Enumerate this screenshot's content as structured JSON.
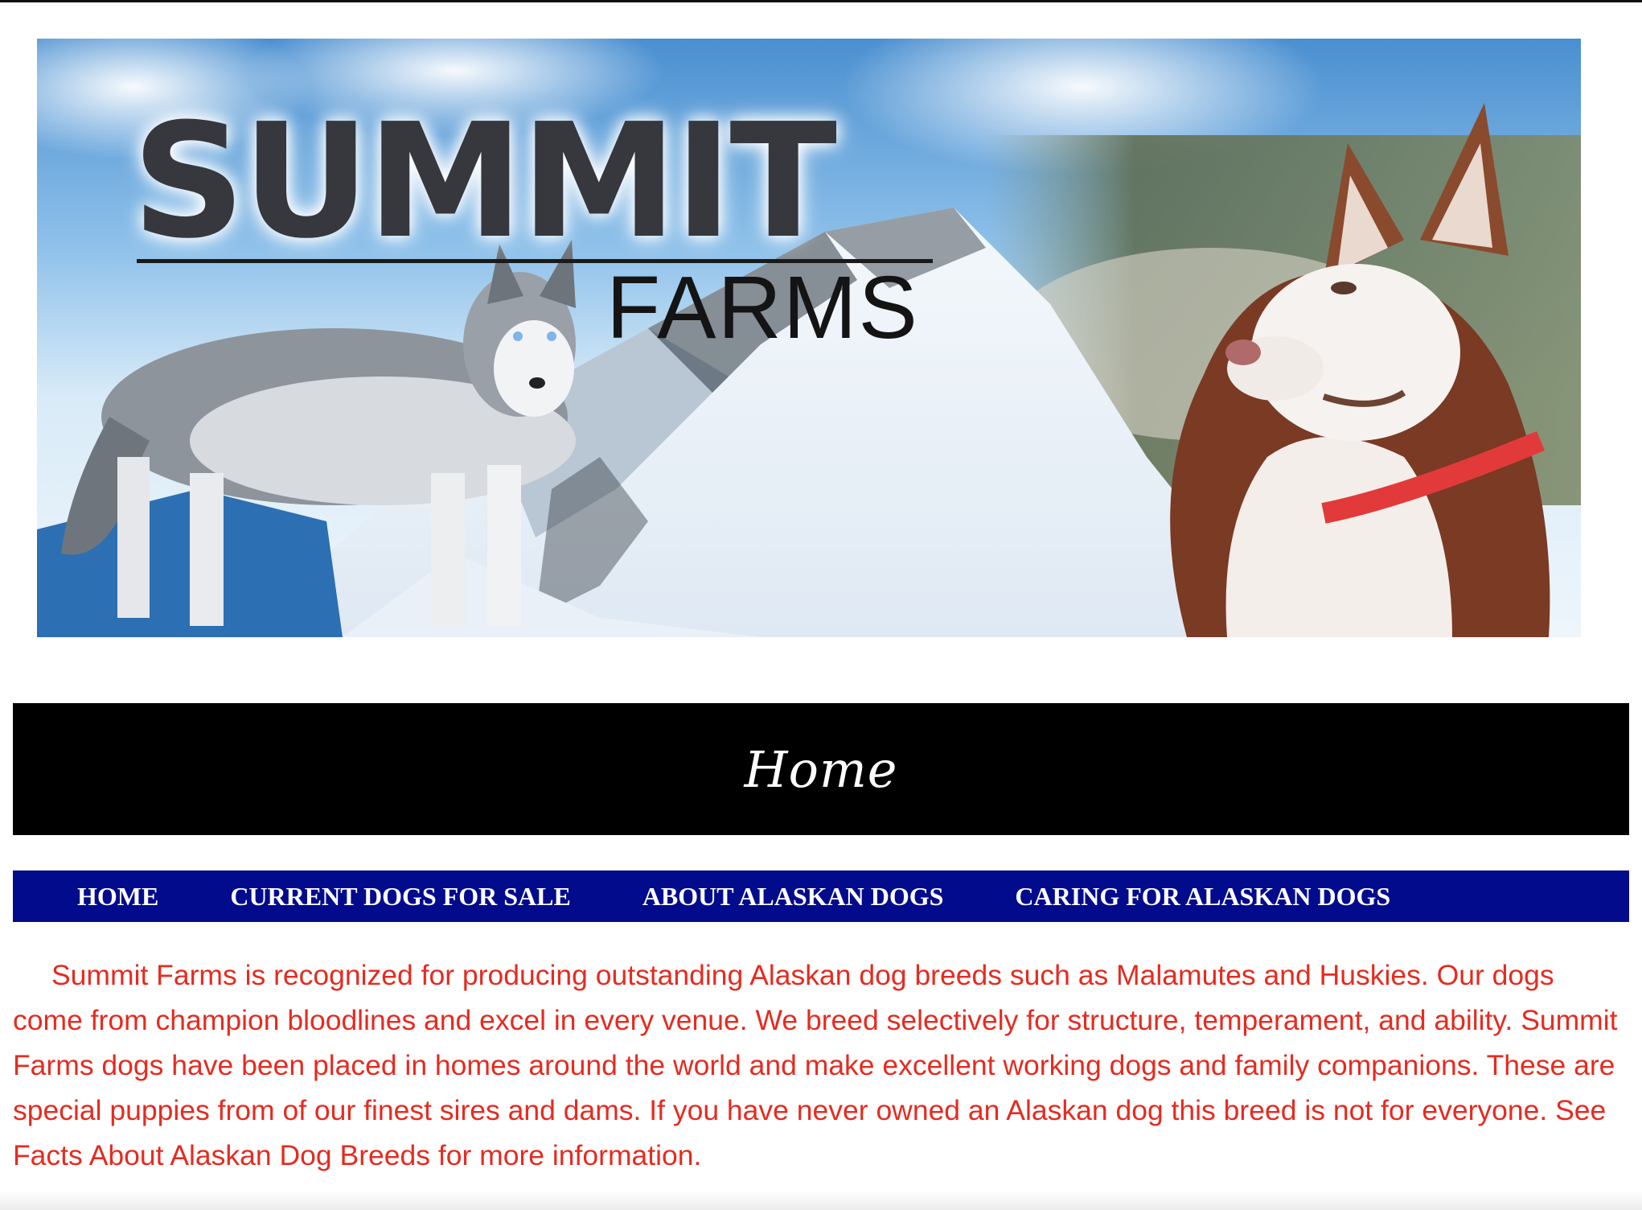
{
  "banner": {
    "logo_main": "SUMMIT",
    "logo_sub": "FARMS",
    "image_alt": "Summit Farms banner with two huskies and a snowy mountain"
  },
  "page": {
    "title": "Home"
  },
  "nav": {
    "items": [
      {
        "label": "HOME"
      },
      {
        "label": "CURRENT DOGS FOR SALE"
      },
      {
        "label": "ABOUT ALASKAN DOGS"
      },
      {
        "label": "CARING FOR ALASKAN DOGS"
      }
    ]
  },
  "content": {
    "intro": "Summit Farms is recognized for producing outstanding Alaskan dog breeds such as Malamutes and Huskies. Our dogs come from champion bloodlines and excel in every venue. We breed selectively for structure, temperament, and ability. Summit Farms dogs have been placed in homes around the world and make excellent working dogs and family companions. These are special puppies from of our finest sires and dams. If you have never owned an Alaskan dog this breed is not for everyone. See Facts About Alaskan Dog Breeds for more information."
  },
  "colors": {
    "title_bar": "#000000",
    "nav_bar": "#020b8c",
    "body_text": "#e52b20"
  }
}
